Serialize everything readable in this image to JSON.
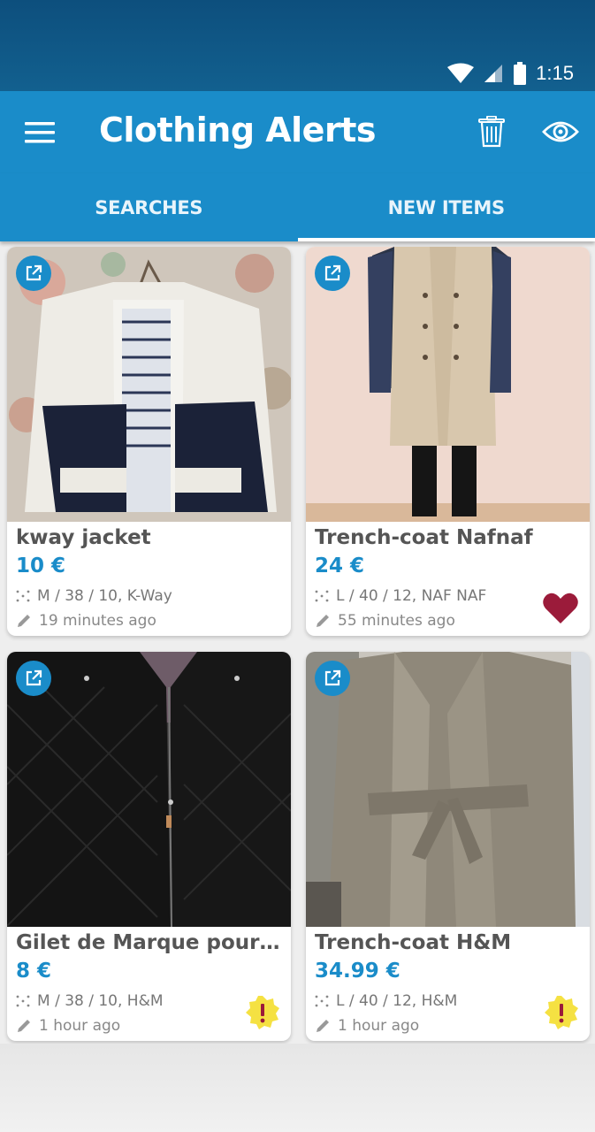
{
  "status_bar": {
    "time": "1:15"
  },
  "app_bar": {
    "title": "Clothing Alerts"
  },
  "tabs": [
    {
      "label": "SEARCHES",
      "active": false
    },
    {
      "label": "NEW ITEMS",
      "active": true
    }
  ],
  "items": [
    {
      "title": "kway jacket",
      "price": "10 €",
      "size": "M / 38 / 10, K-Way",
      "time": "19 minutes ago",
      "badge": "none"
    },
    {
      "title": "Trench-coat Nafnaf",
      "price": "24 €",
      "size": "L / 40 / 12, NAF NAF",
      "time": "55 minutes ago",
      "badge": "heart"
    },
    {
      "title": "Gilet de Marque pour ...",
      "price": "8 €",
      "size": "M / 38 / 10, H&M",
      "time": "1 hour ago",
      "badge": "warning"
    },
    {
      "title": "Trench-coat H&M",
      "price": "34.99 €",
      "size": "L / 40 / 12, H&M",
      "time": "1 hour ago",
      "badge": "warning"
    }
  ],
  "colors": {
    "primary": "#1a8cc9",
    "status_bar": "#0d4f7d",
    "heart": "#9b1b3a",
    "warning": "#f5e142"
  },
  "icons": [
    "menu-icon",
    "trash-icon",
    "eye-icon",
    "external-link-icon",
    "size-icon",
    "pencil-icon",
    "heart-icon",
    "warning-icon",
    "wifi-icon",
    "signal-icon",
    "battery-icon"
  ]
}
